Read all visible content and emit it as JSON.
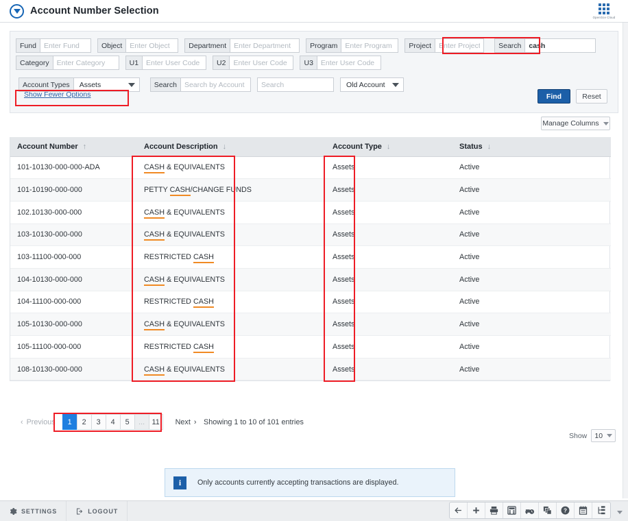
{
  "header": {
    "title": "Account Number Selection",
    "logo_icon": "circle-down-arrow-icon",
    "switcher_icon": "app-grid-icon",
    "switcher_label": "OpenGov Cloud"
  },
  "search_panel": {
    "row1": [
      {
        "label": "Fund",
        "placeholder": "Enter Fund",
        "value": ""
      },
      {
        "label": "Object",
        "placeholder": "Enter Object",
        "value": ""
      },
      {
        "label": "Department",
        "placeholder": "Enter Department",
        "value": ""
      },
      {
        "label": "Program",
        "placeholder": "Enter Program",
        "value": ""
      },
      {
        "label": "Project",
        "placeholder": "Enter Project",
        "value": ""
      },
      {
        "label": "Search",
        "placeholder": "",
        "value": "cash"
      }
    ],
    "row2": [
      {
        "label": "Category",
        "placeholder": "Enter Category",
        "value": ""
      },
      {
        "label": "U1",
        "placeholder": "Enter User Code",
        "value": ""
      },
      {
        "label": "U2",
        "placeholder": "Enter User Code",
        "value": ""
      },
      {
        "label": "U3",
        "placeholder": "Enter User Code",
        "value": ""
      }
    ],
    "row3": {
      "account_types_label": "Account Types",
      "account_types_value": "Assets",
      "search_label": "Search",
      "search_by_account_placeholder": "Search by Account",
      "search_plain_placeholder": "Search",
      "old_account_value": "Old Account"
    },
    "show_fewer_options": "Show Fewer Options",
    "find_button": "Find",
    "reset_button": "Reset",
    "manage_columns": "Manage Columns"
  },
  "table": {
    "columns": [
      {
        "label": "Account Number",
        "sort": "asc"
      },
      {
        "label": "Account Description",
        "sort": "desc"
      },
      {
        "label": "Account  Type",
        "sort": "desc"
      },
      {
        "label": "Status",
        "sort": "desc"
      }
    ],
    "rows": [
      {
        "number": "101-10130-000-000-ADA",
        "desc_pre": "",
        "desc_hl": "CASH",
        "desc_post": " & EQUIVALENTS",
        "type": "Assets",
        "status": "Active"
      },
      {
        "number": "101-10190-000-000",
        "desc_pre": "PETTY ",
        "desc_hl": "CASH",
        "desc_post": "/CHANGE FUNDS",
        "type": "Assets",
        "status": "Active"
      },
      {
        "number": "102.10130-000-000",
        "desc_pre": "",
        "desc_hl": "CASH",
        "desc_post": " & EQUIVALENTS",
        "type": "Assets",
        "status": "Active"
      },
      {
        "number": "103-10130-000-000",
        "desc_pre": "",
        "desc_hl": "CASH",
        "desc_post": " & EQUIVALENTS",
        "type": "Assets",
        "status": "Active"
      },
      {
        "number": "103-11100-000-000",
        "desc_pre": "RESTRICTED ",
        "desc_hl": "CASH",
        "desc_post": "",
        "type": "Assets",
        "status": "Active"
      },
      {
        "number": "104-10130-000-000",
        "desc_pre": "",
        "desc_hl": "CASH",
        "desc_post": " & EQUIVALENTS",
        "type": "Assets",
        "status": "Active"
      },
      {
        "number": "104-11100-000-000",
        "desc_pre": "RESTRICTED ",
        "desc_hl": "CASH",
        "desc_post": "",
        "type": "Assets",
        "status": "Active"
      },
      {
        "number": "105-10130-000-000",
        "desc_pre": "",
        "desc_hl": "CASH",
        "desc_post": " & EQUIVALENTS",
        "type": "Assets",
        "status": "Active"
      },
      {
        "number": "105-11100-000-000",
        "desc_pre": "RESTRICTED ",
        "desc_hl": "CASH",
        "desc_post": "",
        "type": "Assets",
        "status": "Active"
      },
      {
        "number": "108-10130-000-000",
        "desc_pre": "",
        "desc_hl": "CASH",
        "desc_post": " & EQUIVALENTS",
        "type": "Assets",
        "status": "Active"
      }
    ]
  },
  "pagination": {
    "previous": "Previous",
    "next": "Next",
    "pages": [
      "1",
      "2",
      "3",
      "4",
      "5",
      "...",
      "11"
    ],
    "current_page": "1",
    "showing": "Showing 1 to 10 of 101 entries",
    "show_label": "Show",
    "show_value": "10"
  },
  "info": {
    "icon": "info-icon",
    "text": "Only accounts currently accepting transactions are displayed."
  },
  "bottom_bar": {
    "settings": "SETTINGS",
    "logout": "LOGOUT",
    "tools": [
      "back-arrow-icon",
      "plus-icon",
      "printer-icon",
      "calculator-icon",
      "vehicle-clock-icon",
      "layers-icon",
      "help-question-icon",
      "calendar-icon",
      "hierarchy-tree-icon"
    ]
  },
  "colors": {
    "accent_blue": "#1c5fa8",
    "highlight_orange": "#f08a24",
    "annotation_red": "#ee1c25",
    "pager_active": "#1f7fe0"
  }
}
